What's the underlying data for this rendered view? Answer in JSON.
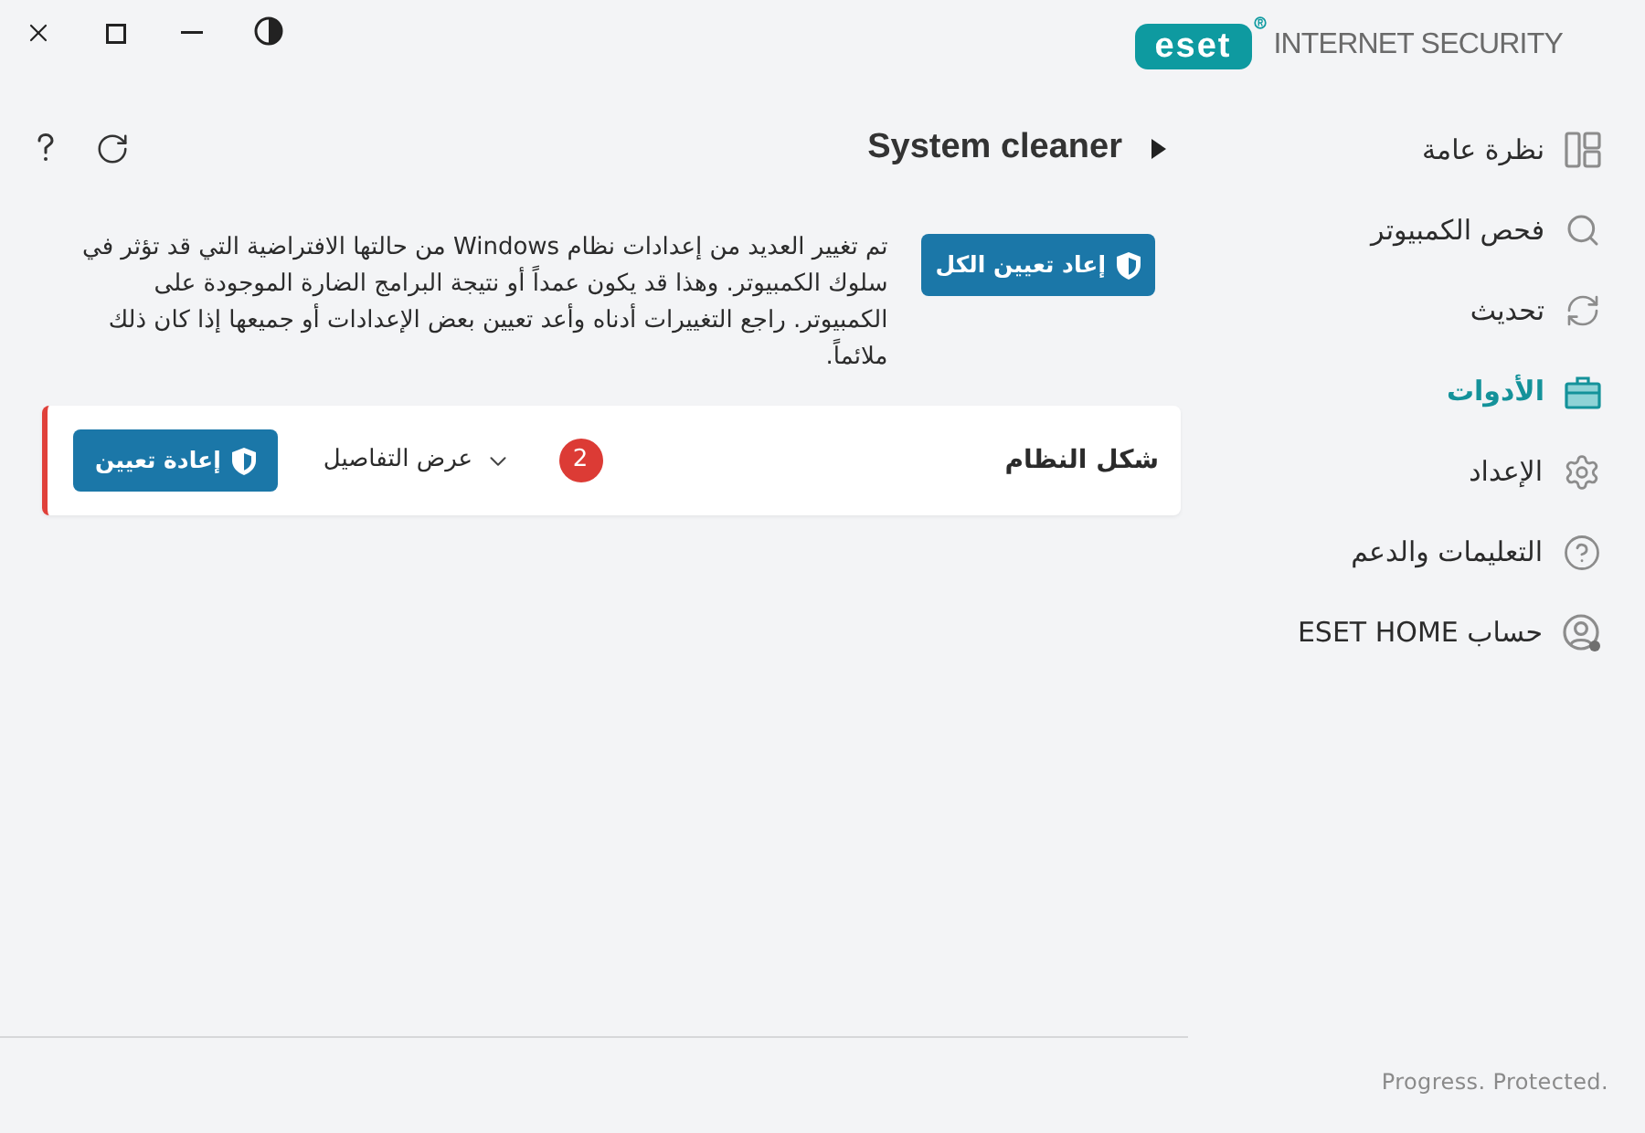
{
  "logo": {
    "brand": "eset",
    "product": "INTERNET SECURITY"
  },
  "header": {
    "title": "System cleaner"
  },
  "intro": {
    "text": "تم تغيير العديد من إعدادات نظام Windows من حالتها الافتراضية التي قد تؤثر في سلوك الكمبيوتر. وهذا قد يكون عمداً أو نتيجة البرامج الضارة الموجودة على الكمبيوتر. راجع التغييرات أدناه وأعد تعيين بعض الإعدادات أو جميعها إذا كان ذلك ملائماً.",
    "button": "إعاد تعيين الكل"
  },
  "changes": [
    {
      "title": "شكل النظام",
      "count": "2",
      "details": "عرض التفاصيل",
      "expanded": false,
      "button": "إعادة تعيين"
    }
  ],
  "sidebar": {
    "items": [
      {
        "label": "نظرة عامة",
        "selected": false
      },
      {
        "label": "فحص الكمبيوتر",
        "selected": false
      },
      {
        "label": "تحديث",
        "selected": false
      },
      {
        "label": "الأدوات",
        "selected": true
      },
      {
        "label": "الإعداد",
        "selected": false
      },
      {
        "label": "التعليمات والدعم",
        "selected": false
      },
      {
        "label": "حساب ESET HOME",
        "selected": false
      }
    ]
  },
  "footer": {
    "tagline": "Progress. Protected."
  }
}
